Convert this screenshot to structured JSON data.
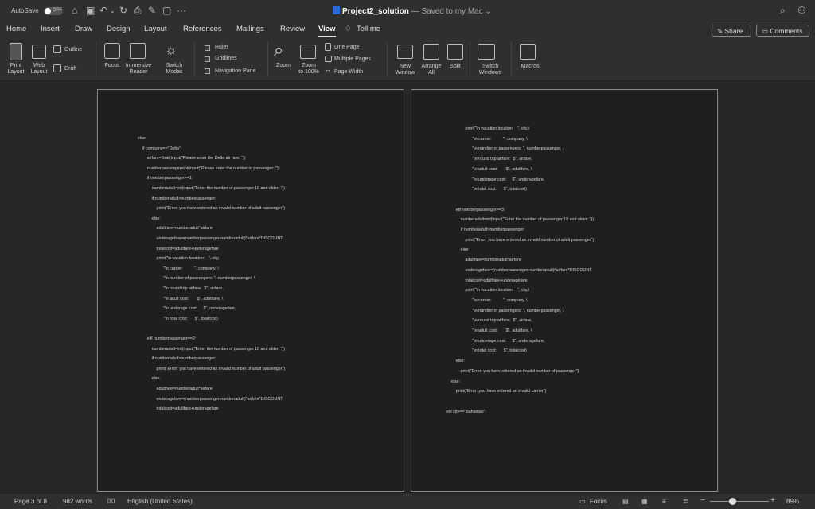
{
  "title_bar": {
    "autosave_label": "AutoSave",
    "autosave_state": "OFF",
    "document_name": "Project2_solution",
    "saved_status": " — Saved to my Mac",
    "more": "···"
  },
  "menu": {
    "tabs": [
      "Home",
      "Insert",
      "Draw",
      "Design",
      "Layout",
      "References",
      "Mailings",
      "Review",
      "View"
    ],
    "active_tab": "View",
    "tell_me": "Tell me",
    "share": "Share",
    "comments": "Comments"
  },
  "ribbon": {
    "print_layout": [
      "Print",
      "Layout"
    ],
    "web_layout": [
      "Web",
      "Layout"
    ],
    "outline": "Outline",
    "draft": "Draft",
    "focus": "Focus",
    "immersive_reader": [
      "Immersive",
      "Reader"
    ],
    "switch_modes": [
      "Switch",
      "Modes"
    ],
    "ruler": "Ruler",
    "gridlines": "Gridlines",
    "navigation_pane": "Navigation Pane",
    "zoom": "Zoom",
    "zoom_100": [
      "Zoom",
      "to 100%"
    ],
    "one_page": "One Page",
    "multiple_pages": "Multiple Pages",
    "page_width": "Page Width",
    "new_window": [
      "New",
      "Window"
    ],
    "arrange_all": [
      "Arrange",
      "All"
    ],
    "split": "Split",
    "switch_windows": [
      "Switch",
      "Windows"
    ],
    "macros": "Macros"
  },
  "page_left": {
    "lines": [
      "else:",
      "    if company==\"Delta\":",
      "        airfare=float(input(\"Please enter the Delta air fare: \"))",
      "        numberpassenger=int(input(\"Please enter the number of passenger: \"))",
      "        if numberpassenger==1:",
      "            numberadult=int(input(\"Enter the number of passenger 18 and older: \"))",
      "            if numberadult>numberpassenger:",
      "                print(\"Error: you have entered an invalid number of adult passenger\")",
      "            else:",
      "                adultfare=numberadult*airfare",
      "                underagefare=(numberpassenger-numberadult)*airfare*DISCOUNT",
      "                totalcost=adultfare+underagefare",
      "                print(\"\\n vacation location:   \", city,\\",
      "                      \"\\n carrier:          \", company, \\",
      "                      \"\\n number of passengers: \", numberpassenger, \\",
      "                      \"\\n round trip airfare:  $\", airfare,",
      "                      \"\\n adult cost:       $\", adultfare, \\",
      "                      \"\\n underage cost:     $\", underagefare,",
      "                      \"\\n total cost:      $\", totalcost)",
      "",
      "        elif numberpassenger==2:",
      "            numberadult=int(input(\"Enter the number of passenger 18 and older: \"))",
      "            if numberadult>numberpassenger:",
      "                print(\"Error: you have entered an invalid number of adult passenger\")",
      "            else:",
      "                adultfare=numberadult*airfare",
      "                underagefare=(numberpassenger-numberadult)*airfare*DISCOUNT",
      "                totalcost=adultfare+underagefare"
    ]
  },
  "page_right": {
    "lines": [
      "                print(\"\\n vacation location:   \", city,\\",
      "                      \"\\n carrier:          \", company, \\",
      "                      \"\\n number of passengers: \", numberpassenger, \\",
      "                      \"\\n round trip airfare:  $\", airfare,",
      "                      \"\\n adult cost:       $\", adultfare, \\",
      "                      \"\\n underage cost:     $\", underagefare,",
      "                      \"\\n total cost:      $\", totalcost)",
      "",
      "        elif numberpassenger==3:",
      "            numberadult=int(input(\"Enter the number of passenger 18 and older: \"))",
      "            if numberadult>numberpassenger:",
      "                print(\"Error: you have entered an invalid number of adult passenger\")",
      "            else:",
      "                adultfare=numberadult*airfare",
      "                underagefare=(numberpassenger-numberadult)*airfare*DISCOUNT",
      "                totalcost=adultfare+underagefare",
      "                print(\"\\n vacation location:   \", city,\\",
      "                      \"\\n carrier:          \", company, \\",
      "                      \"\\n number of passengers: \", numberpassenger, \\",
      "                      \"\\n round trip airfare:  $\", airfare,",
      "                      \"\\n adult cost:       $\", adultfare, \\",
      "                      \"\\n underage cost:     $\", underagefare,",
      "                      \"\\n total cost:      $\", totalcost)",
      "        else:",
      "            print(\"Error: you have entered an invalid number of passenger\")",
      "    else:",
      "        print(\"Error: you have entered an invalid carrier\")",
      "",
      "elif city==\"Bahamas\":"
    ]
  },
  "status_bar": {
    "page": "Page 3 of 8",
    "words": "982 words",
    "language": "English (United States)",
    "focus": "Focus",
    "zoom_level": "89%",
    "zoom_fraction": 0.38
  }
}
